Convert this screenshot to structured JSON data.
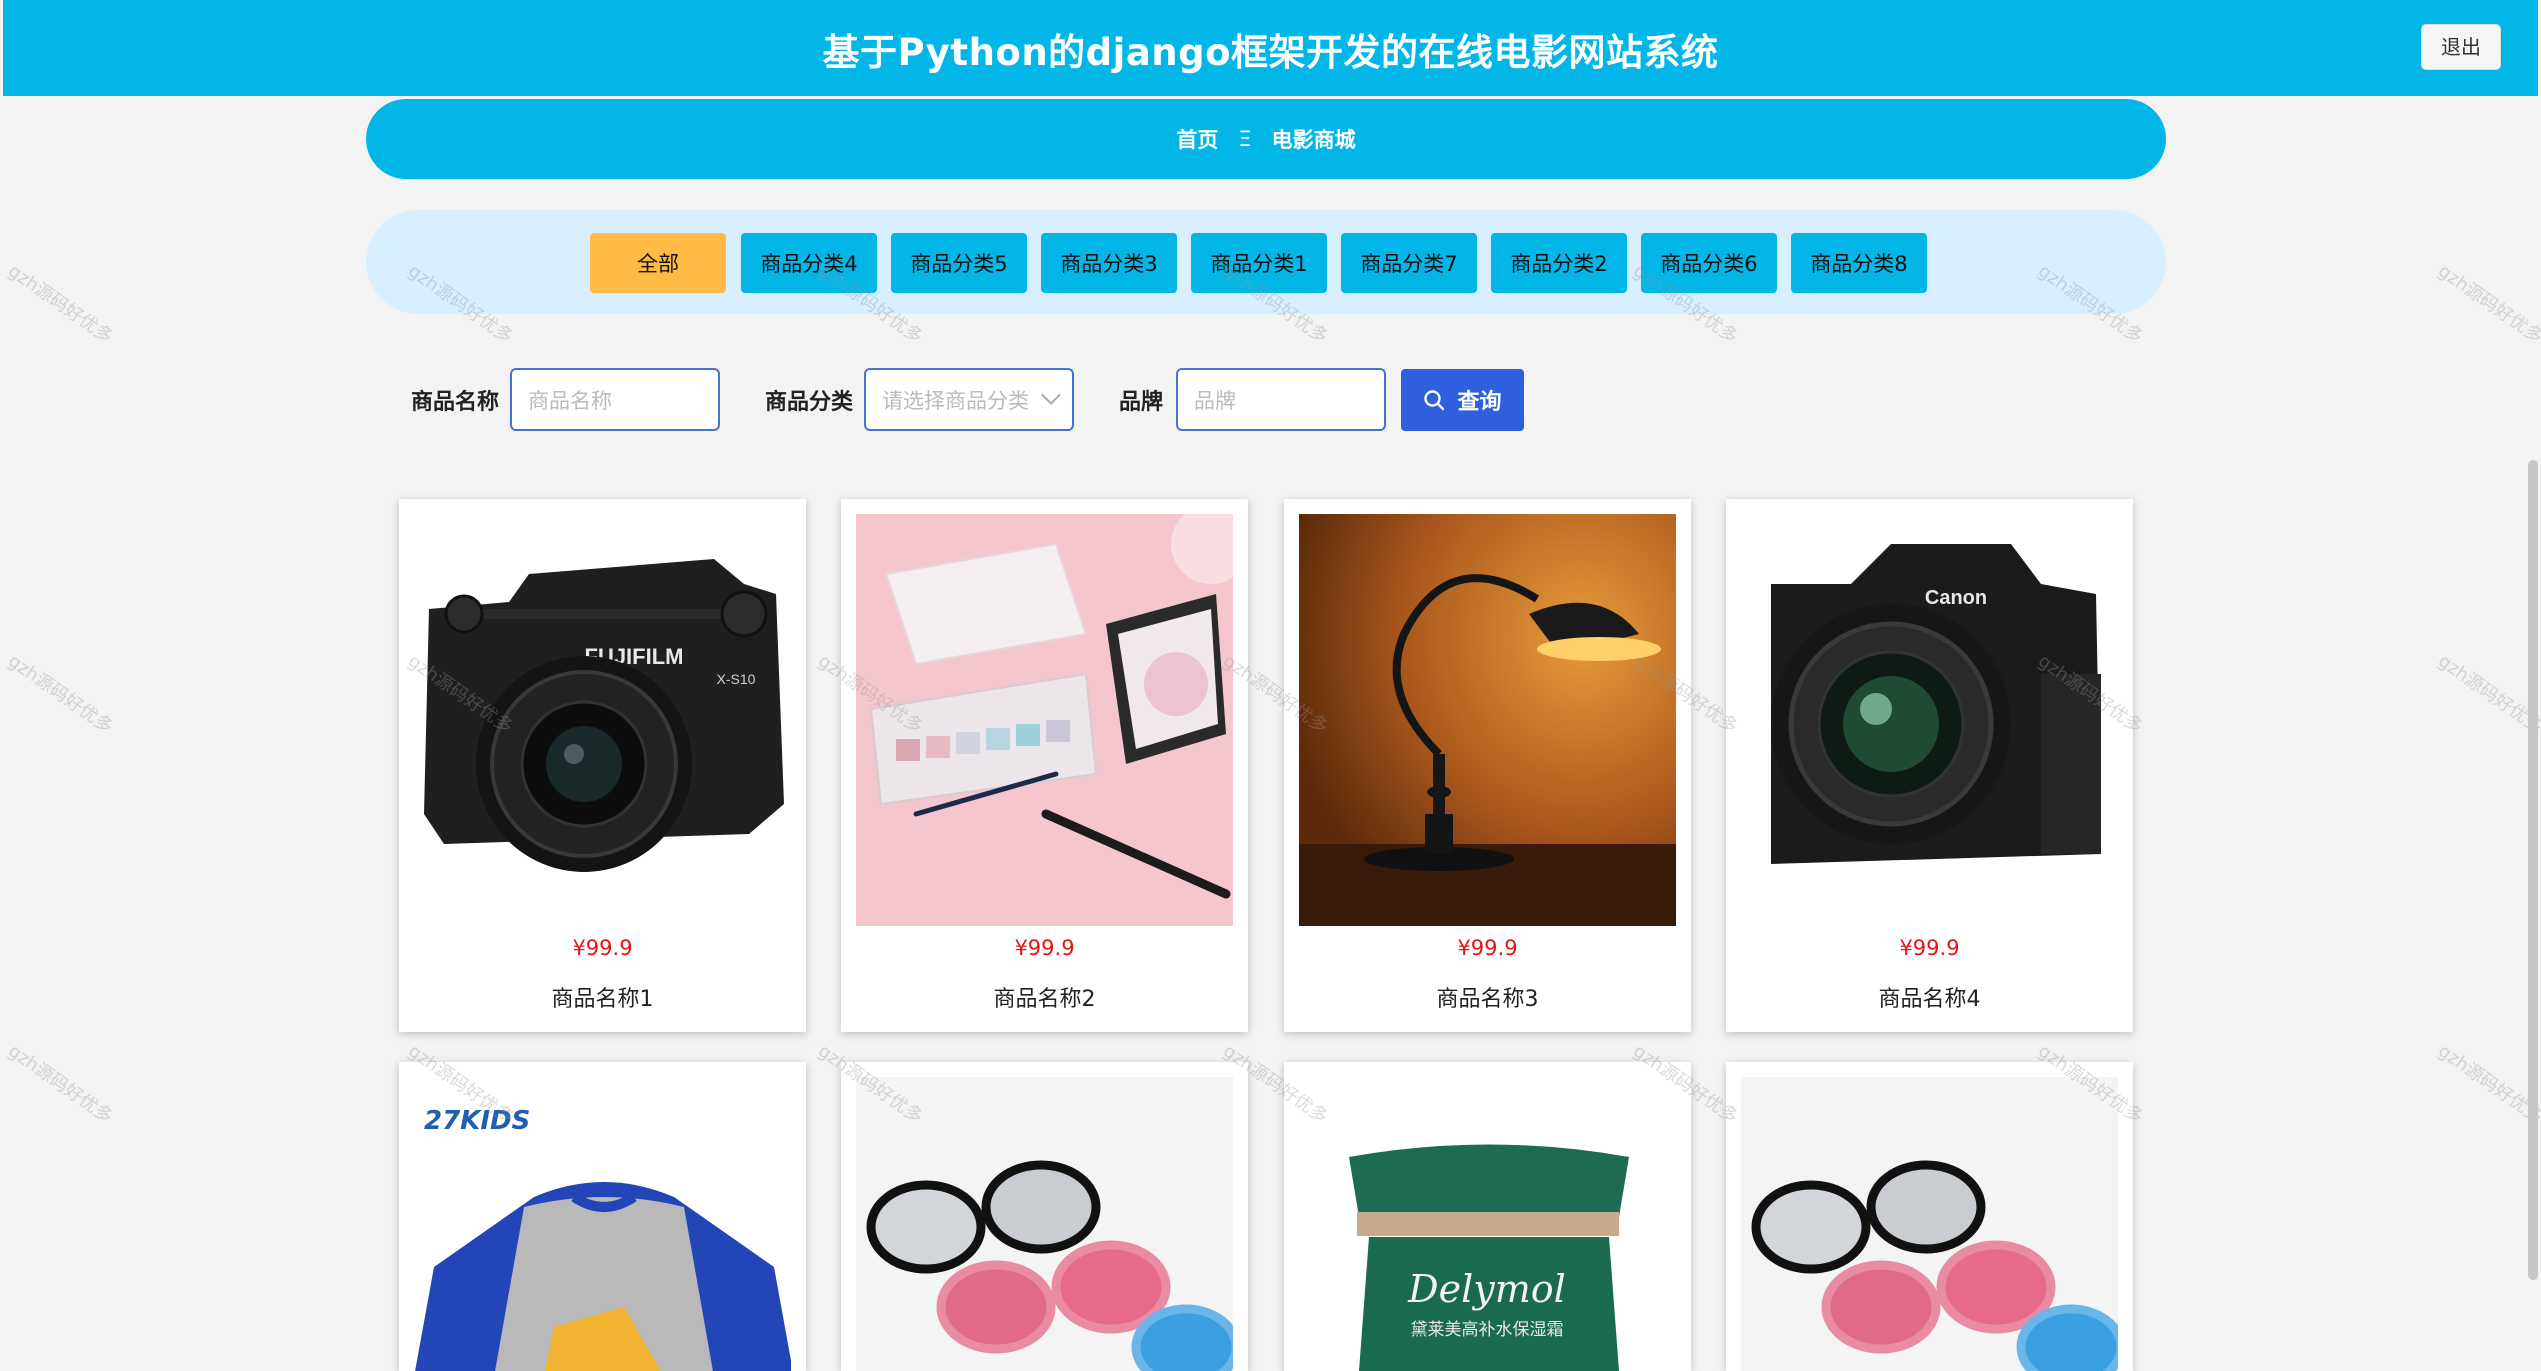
{
  "header": {
    "title": "基于Python的django框架开发的在线电影网站系统",
    "logout_label": "退出"
  },
  "breadcrumb": {
    "home": "首页",
    "separator": "Ξ",
    "current": "电影商城"
  },
  "categories": [
    {
      "label": "全部",
      "active": true
    },
    {
      "label": "商品分类4"
    },
    {
      "label": "商品分类5"
    },
    {
      "label": "商品分类3"
    },
    {
      "label": "商品分类1"
    },
    {
      "label": "商品分类7"
    },
    {
      "label": "商品分类2"
    },
    {
      "label": "商品分类6"
    },
    {
      "label": "商品分类8"
    }
  ],
  "search": {
    "name_label": "商品名称",
    "name_placeholder": "商品名称",
    "category_label": "商品分类",
    "category_placeholder": "请选择商品分类",
    "brand_label": "品牌",
    "brand_placeholder": "品牌",
    "button_label": "查询"
  },
  "products": [
    {
      "price": "¥99.9",
      "name": "商品名称1",
      "image": "camera-fujifilm"
    },
    {
      "price": "¥99.9",
      "name": "商品名称2",
      "image": "cosmetics"
    },
    {
      "price": "¥99.9",
      "name": "商品名称3",
      "image": "desk-lamp"
    },
    {
      "price": "¥99.9",
      "name": "商品名称4",
      "image": "camera-canon"
    },
    {
      "image": "kids-shirt",
      "image_text": "27KIDS"
    },
    {
      "image": "sunglasses"
    },
    {
      "image": "cream-jar",
      "image_text": "Delymol"
    },
    {
      "image": "sunglasses"
    }
  ],
  "image_texts": {
    "fujifilm_brand": "FUJIFILM",
    "fujifilm_model": "X-S10",
    "canon_brand": "Canon",
    "cream_sub": "黛莱美高补水保湿霜"
  },
  "watermark": "gzh源码好优多",
  "colors": {
    "primary": "#03b6e8",
    "active_category": "#ffbb44",
    "search_button": "#2f5fdf",
    "price": "#e31414"
  }
}
